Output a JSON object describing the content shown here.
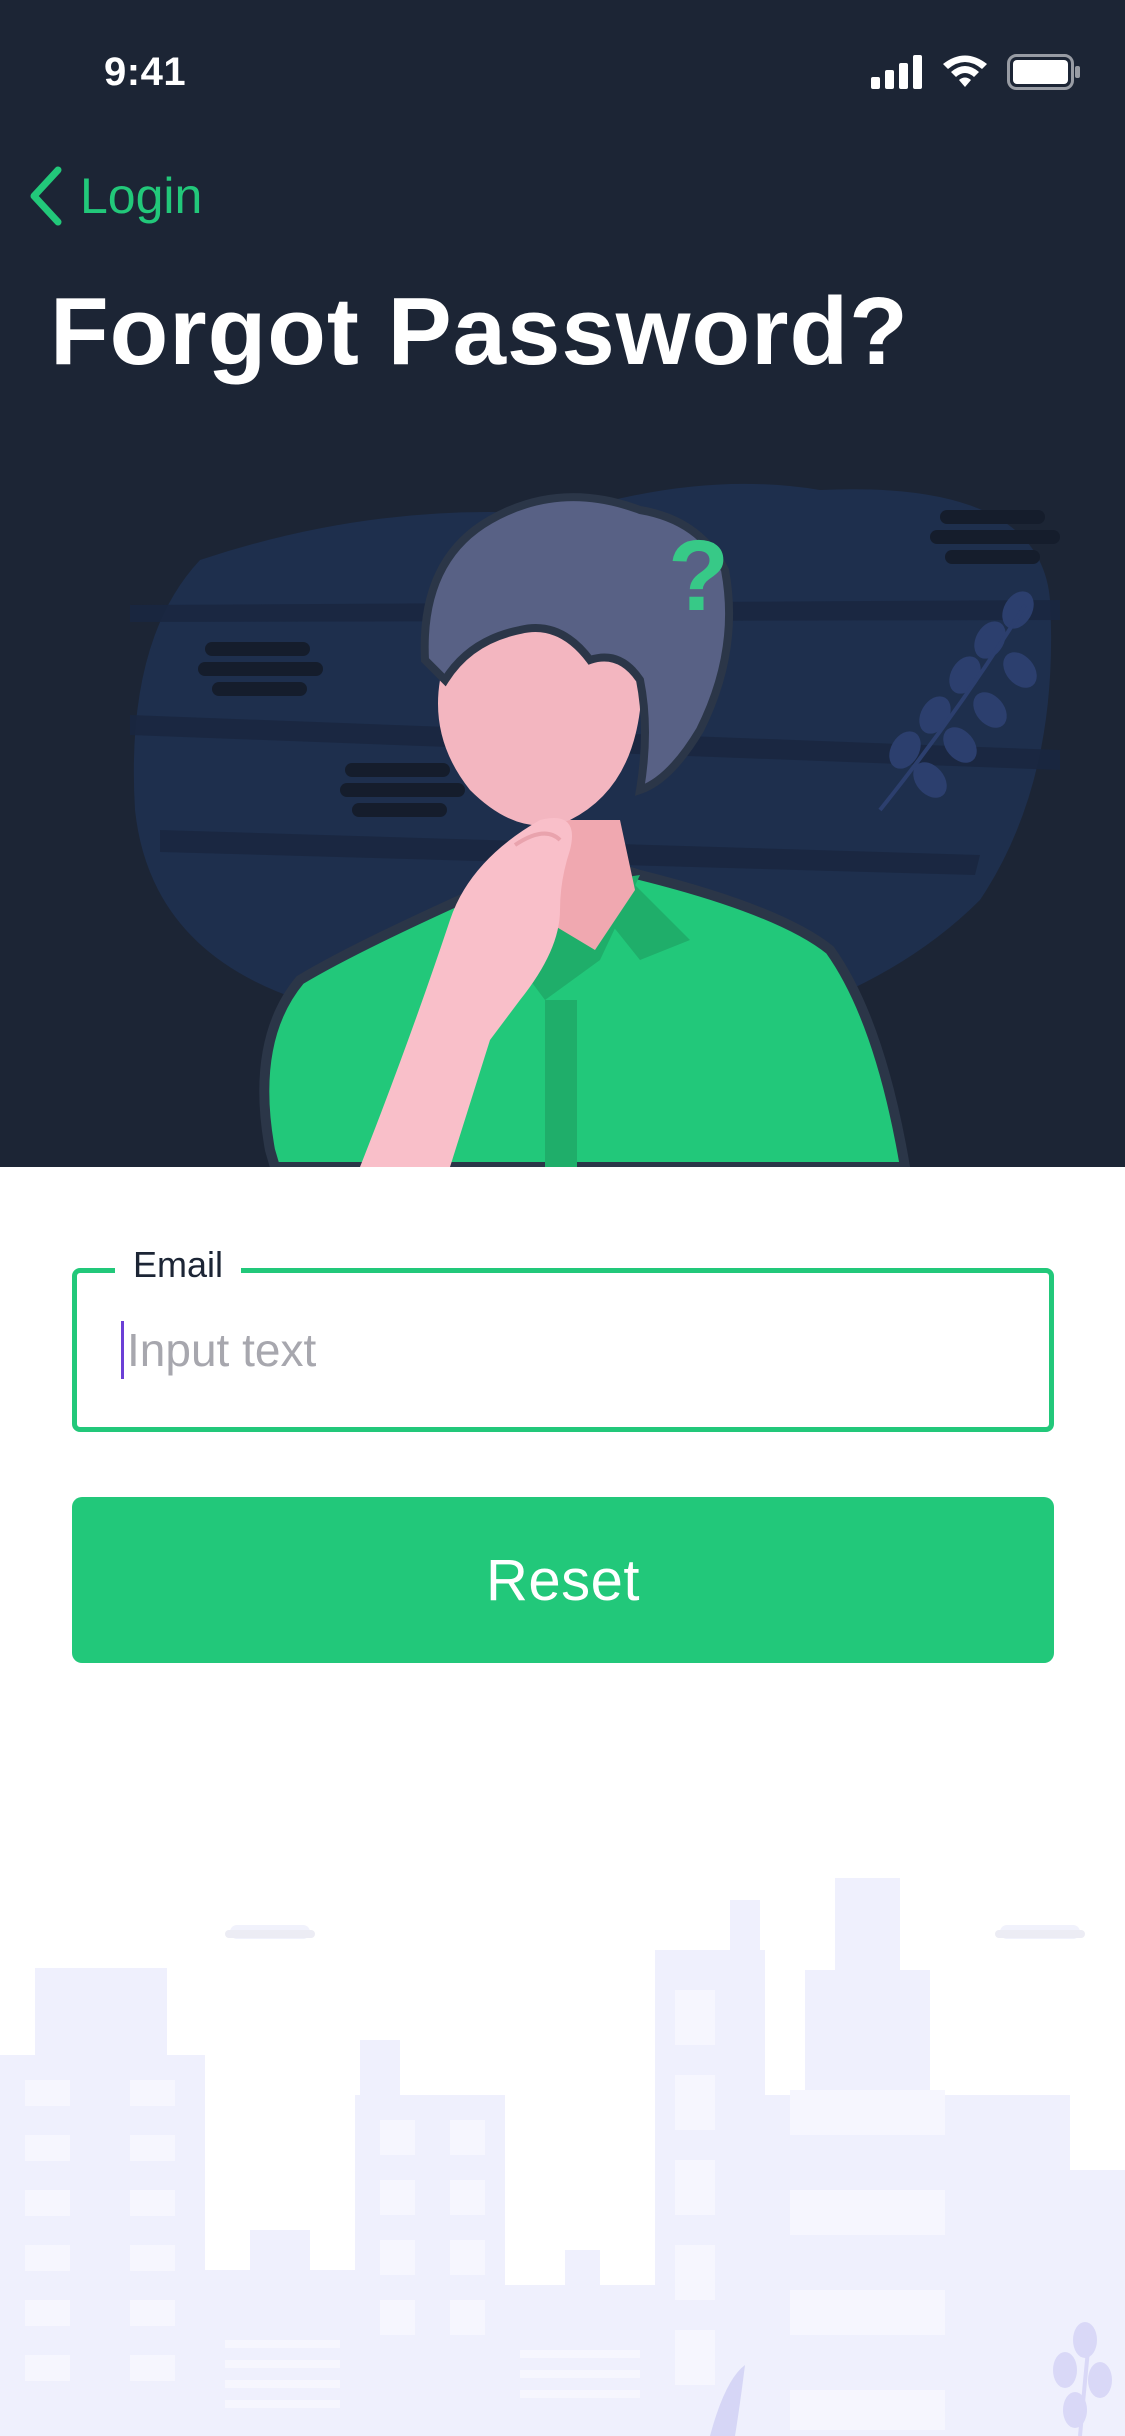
{
  "status_bar": {
    "time": "9:41"
  },
  "nav": {
    "back_label": "Login"
  },
  "header": {
    "title": "Forgot Password?"
  },
  "illustration": {
    "accent_symbol": "?"
  },
  "form": {
    "email_label": "Email",
    "email_placeholder": "Input text",
    "email_value": ""
  },
  "actions": {
    "reset_label": "Reset"
  },
  "colors": {
    "header_bg": "#1c2535",
    "accent": "#22c87a",
    "caret": "#6b3fd6",
    "city_tint": "#eff0fd"
  }
}
